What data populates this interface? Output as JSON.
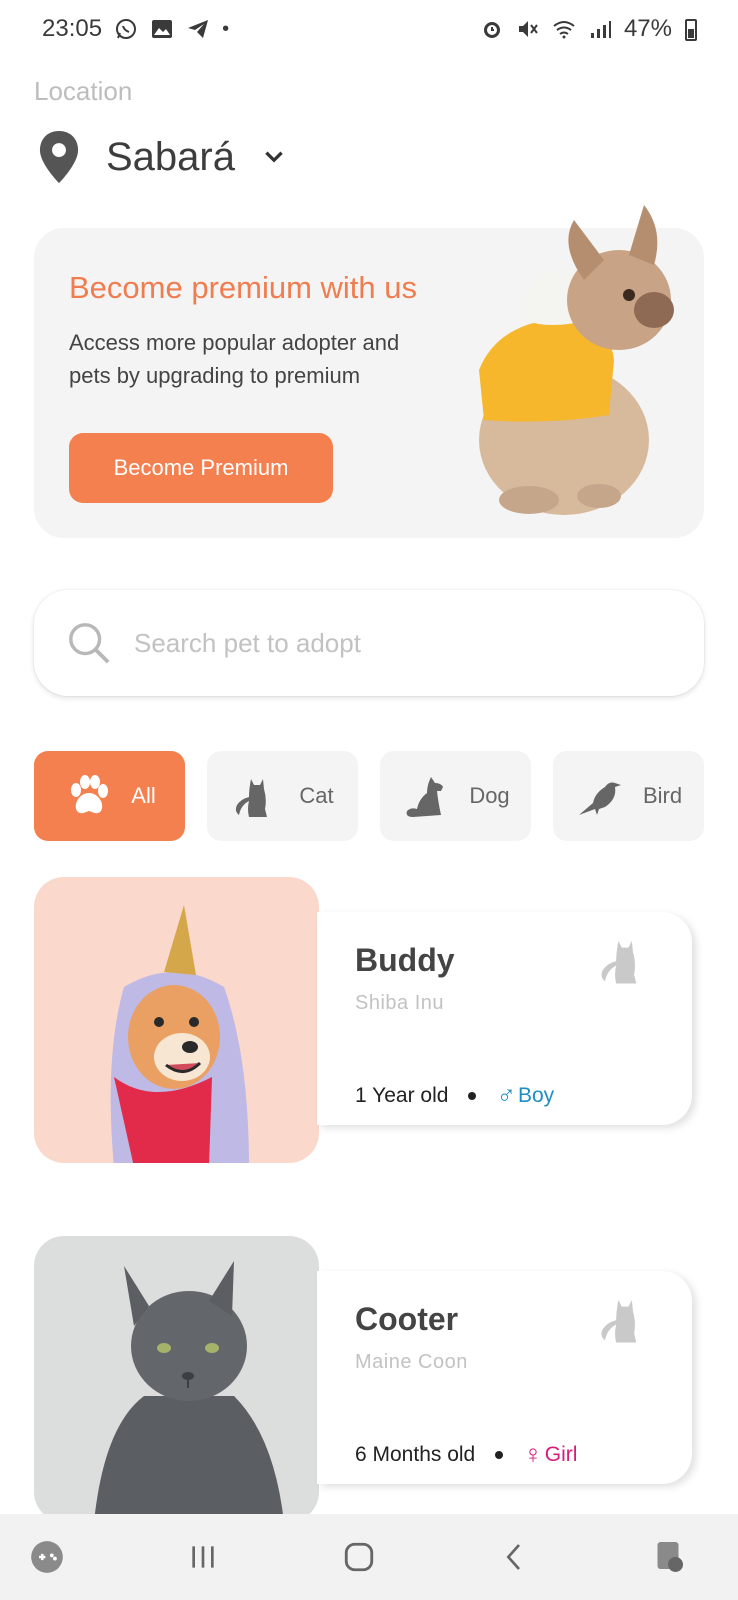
{
  "status_bar": {
    "time": "23:05",
    "battery": "47%",
    "left_icons": [
      "whatsapp-icon",
      "gallery-icon",
      "telegram-icon",
      "dot-icon"
    ],
    "right_icons": [
      "alarm-icon",
      "mute-icon",
      "wifi-icon",
      "signal-icon",
      "battery-icon"
    ]
  },
  "location": {
    "label": "Location",
    "city": "Sabará"
  },
  "premium": {
    "title": "Become premium with us",
    "text": "Access more popular adopter and pets by upgrading to premium",
    "button_label": "Become Premium"
  },
  "search": {
    "placeholder": "Search pet to adopt"
  },
  "categories": [
    {
      "label": "All",
      "icon": "paw-icon",
      "active": true
    },
    {
      "label": "Cat",
      "icon": "cat-icon",
      "active": false
    },
    {
      "label": "Dog",
      "icon": "dog-icon",
      "active": false
    },
    {
      "label": "Bird",
      "icon": "bird-icon",
      "active": false
    }
  ],
  "pets": [
    {
      "name": "Buddy",
      "breed": "Shiba Inu",
      "age": "1 Year old",
      "gender_symbol": "♂",
      "gender": "Boy",
      "gender_color": "#1f8fc1",
      "photo_bg": "#fbd8cc"
    },
    {
      "name": "Cooter",
      "breed": "Maine Coon",
      "age": "6 Months old",
      "gender_symbol": "♀",
      "gender": "Girl",
      "gender_color": "#d81b7a",
      "photo_bg": "#dcdedd"
    }
  ],
  "colors": {
    "accent": "#f47f4f",
    "card_bg": "#f4f4f4",
    "muted_text": "#c2c2c2"
  },
  "navbar": {
    "icons": [
      "game-launcher-icon",
      "recent-apps-icon",
      "home-icon",
      "back-icon",
      "assistant-icon"
    ]
  }
}
